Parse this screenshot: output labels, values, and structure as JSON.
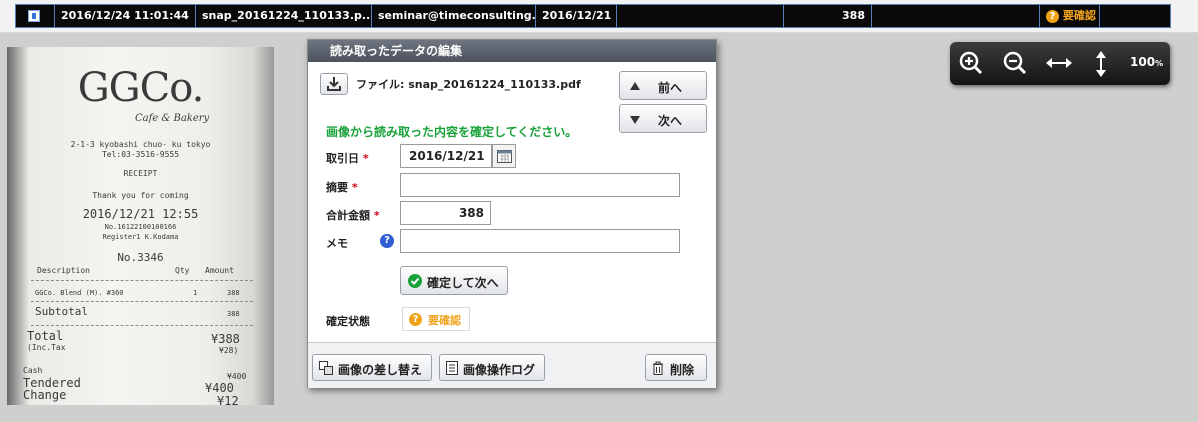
{
  "table_row": {
    "datetime": "2016/12/24 11:01:44",
    "filename": "snap_20161224_110133.p...",
    "email": "seminar@timeconsulting.jp",
    "date": "2016/12/21",
    "amount": "388",
    "status": "要確認"
  },
  "receipt": {
    "logo": "GGCo.",
    "logo_sub": "Cafe & Bakery",
    "address1": "2-1-3 kyobashi chuo- ku tokyo",
    "address2": "Tel:03-3516-9555",
    "receipt_label": "RECEIPT",
    "thanks": "Thank you for coming",
    "datetime": "2016/12/21  12:55",
    "number": "No.16122100100166",
    "register": "Register1  K.Kodama",
    "no": "No.3346",
    "col_desc": "Description",
    "col_qty": "Qty",
    "col_amount": "Amount",
    "item_name": "GGCo. Blend (M). #360",
    "item_qty": "1",
    "item_amount": "388",
    "subtotal_label": "Subtotal",
    "subtotal_value": "388",
    "total_label": "Total",
    "total_sub": "(Inc.Tax",
    "total_value": "¥388",
    "total_tax": "¥28)",
    "cash_label": "Cash",
    "cash_value": "¥400",
    "tendered_label": "Tendered",
    "tendered_value": "¥400",
    "change_label": "Change",
    "change_value": "¥12"
  },
  "dialog": {
    "title": "読み取ったデータの編集",
    "file_label": "ファイル: snap_20161224_110133.pdf",
    "prev_label": "前へ",
    "next_label": "次へ",
    "instruction": "画像から読み取った内容を確定してください。",
    "fields": {
      "date_label": "取引日",
      "date_value": "2016/12/21",
      "summary_label": "摘要",
      "summary_value": "",
      "total_label": "合計金額",
      "total_value": "388",
      "memo_label": "メモ",
      "memo_value": ""
    },
    "confirm_next_label": "確定して次へ",
    "status_label": "確定状態",
    "status_value": "要確認",
    "footer": {
      "replace_image": "画像の差し替え",
      "image_log": "画像操作ログ",
      "delete": "削除"
    }
  },
  "zoom": {
    "level": "100",
    "unit": "%"
  },
  "colors": {
    "confirm_green": "#19a23a",
    "warning_orange": "#f0a318",
    "required_red": "#d0021b"
  }
}
